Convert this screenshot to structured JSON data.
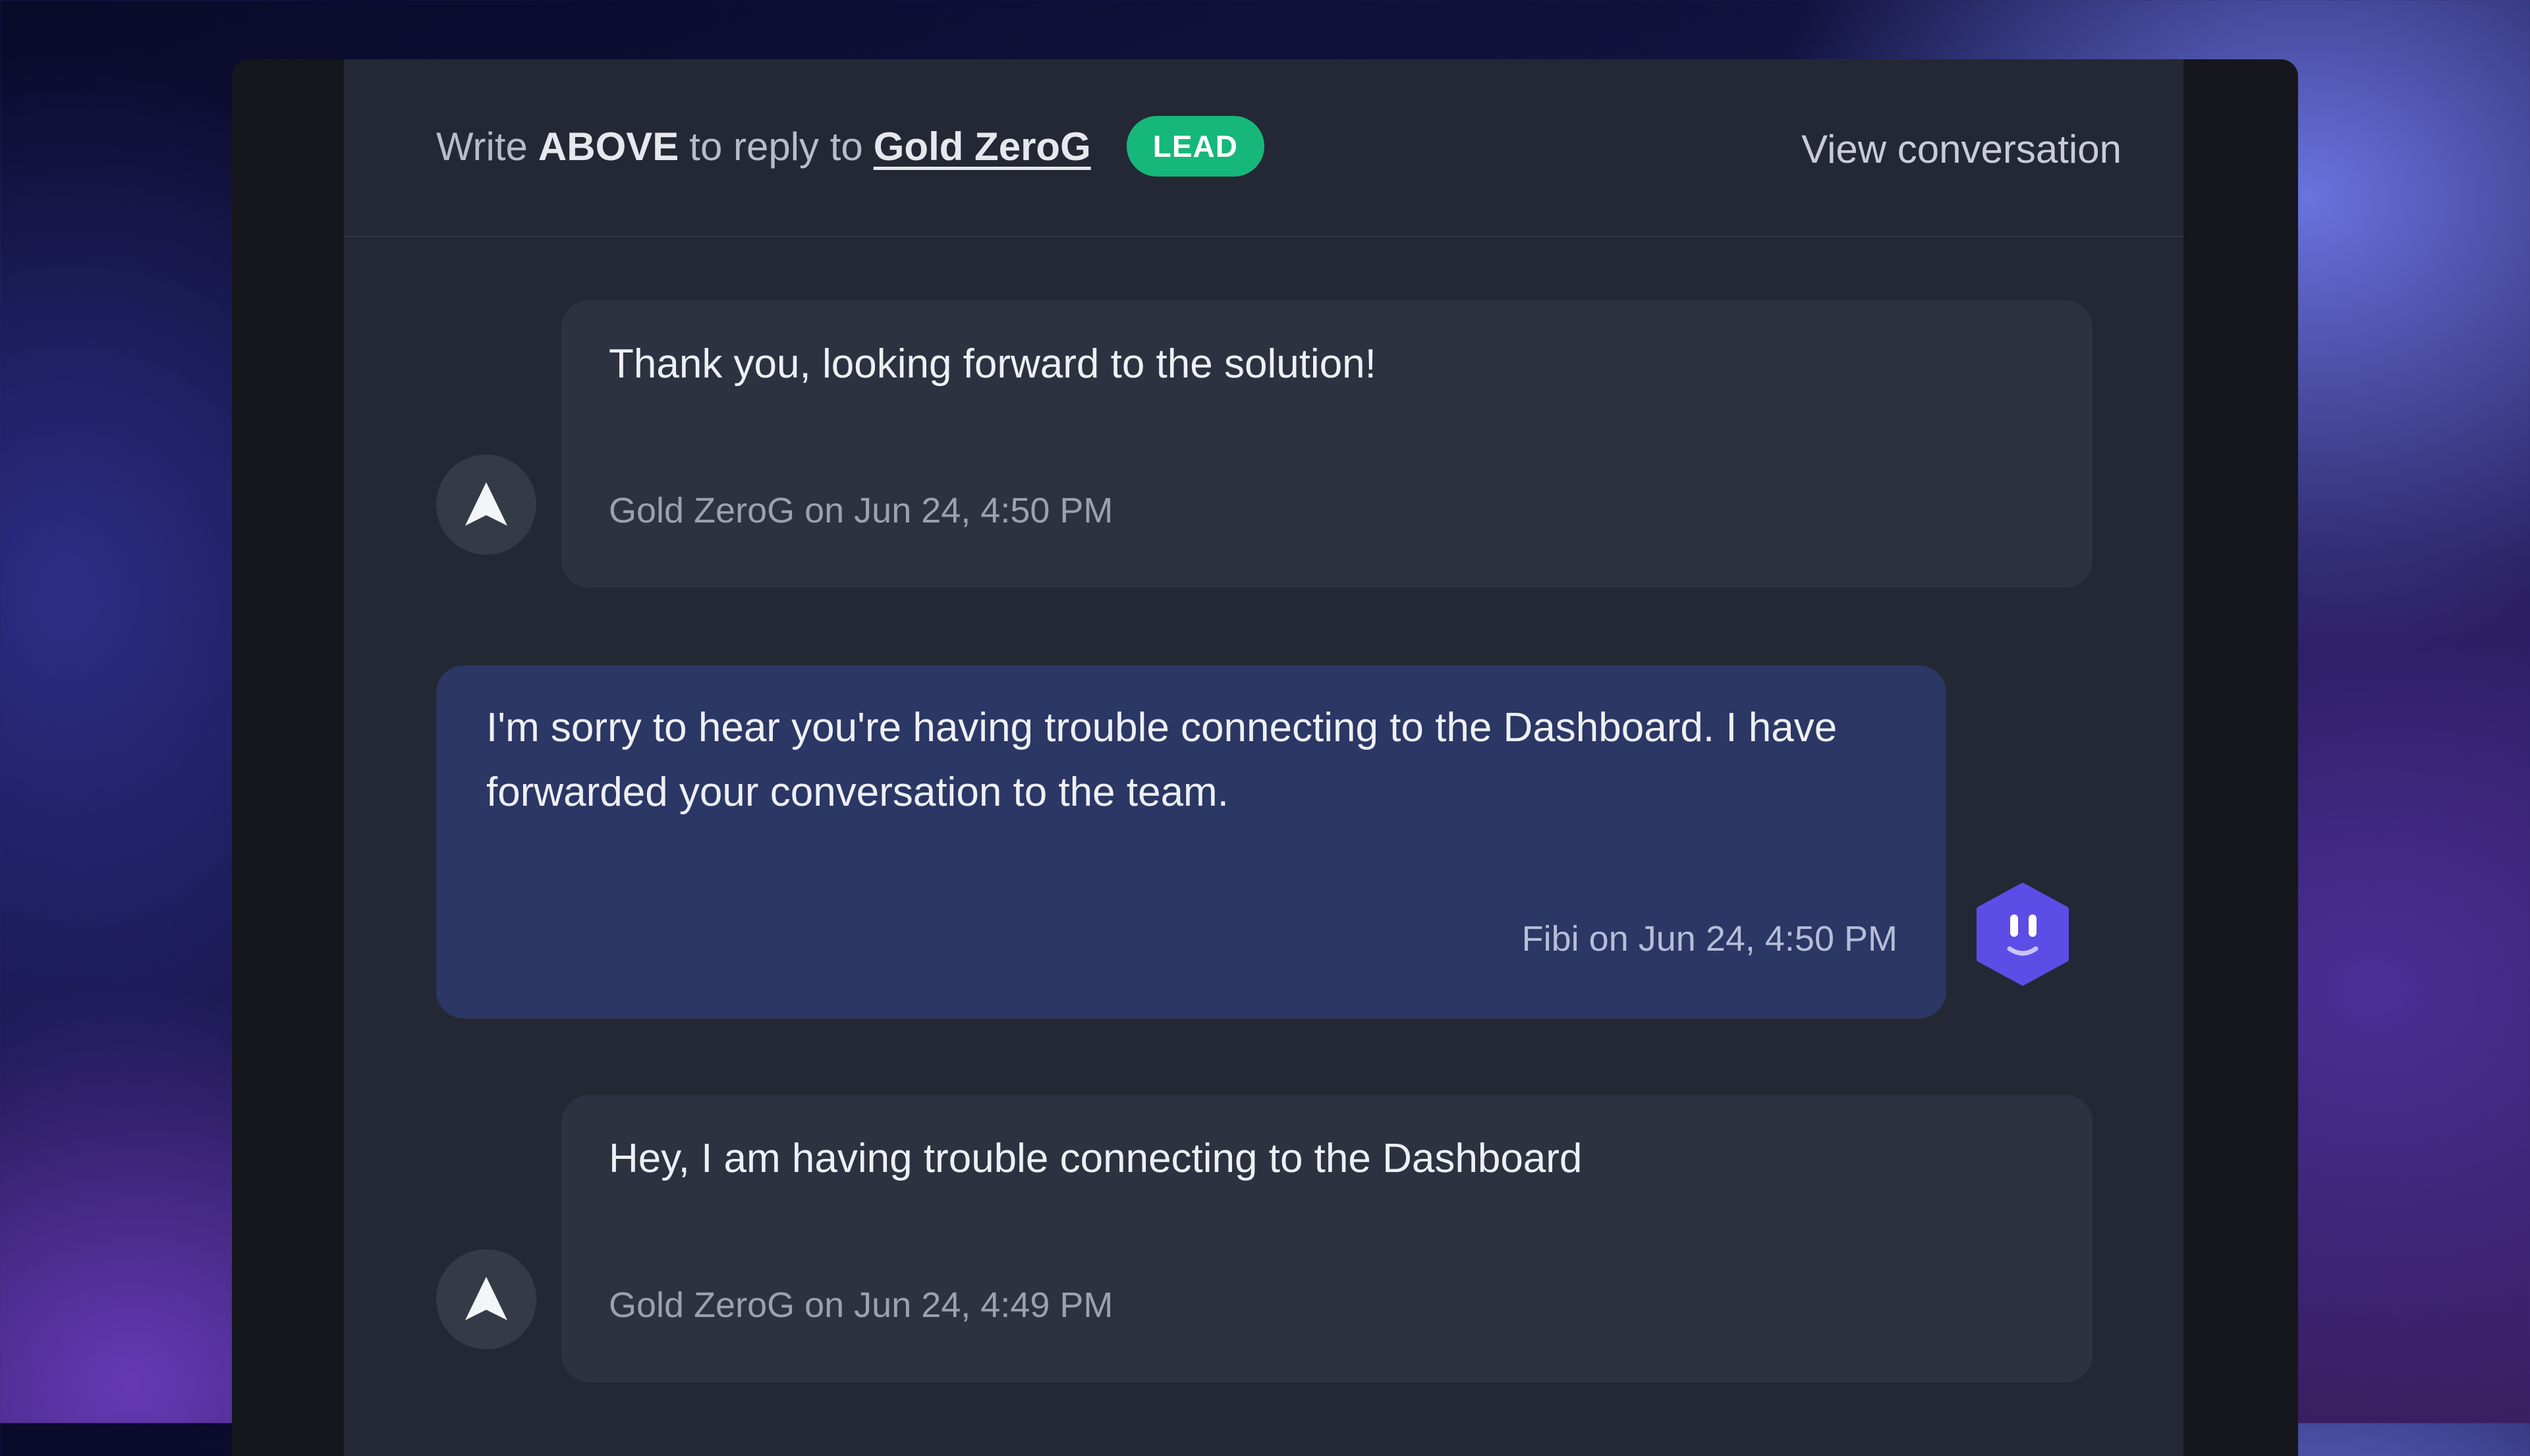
{
  "header": {
    "prefix": "Write",
    "keyword": "ABOVE",
    "middle": "to reply to",
    "contact_name": "Gold ZeroG",
    "badge": "LEAD",
    "badge_color": "#16b77a",
    "view_link": "View conversation"
  },
  "messages": [
    {
      "sender": "user",
      "text": "Thank you, looking forward to the solution!",
      "meta": "Gold ZeroG on Jun 24, 4:50 PM",
      "avatar_icon": "arrow-up-icon"
    },
    {
      "sender": "bot",
      "text": "I'm sorry to hear you're having trouble connecting to the Dashboard. I have forwarded your conversation to the team.",
      "meta": "Fibi on Jun 24, 4:50 PM",
      "avatar_icon": "bot-face-icon",
      "bubble_color": "#2b3764"
    },
    {
      "sender": "user",
      "text": "Hey, I am having trouble connecting to the Dashboard",
      "meta": "Gold ZeroG on Jun 24, 4:49 PM",
      "avatar_icon": "arrow-up-icon"
    }
  ]
}
